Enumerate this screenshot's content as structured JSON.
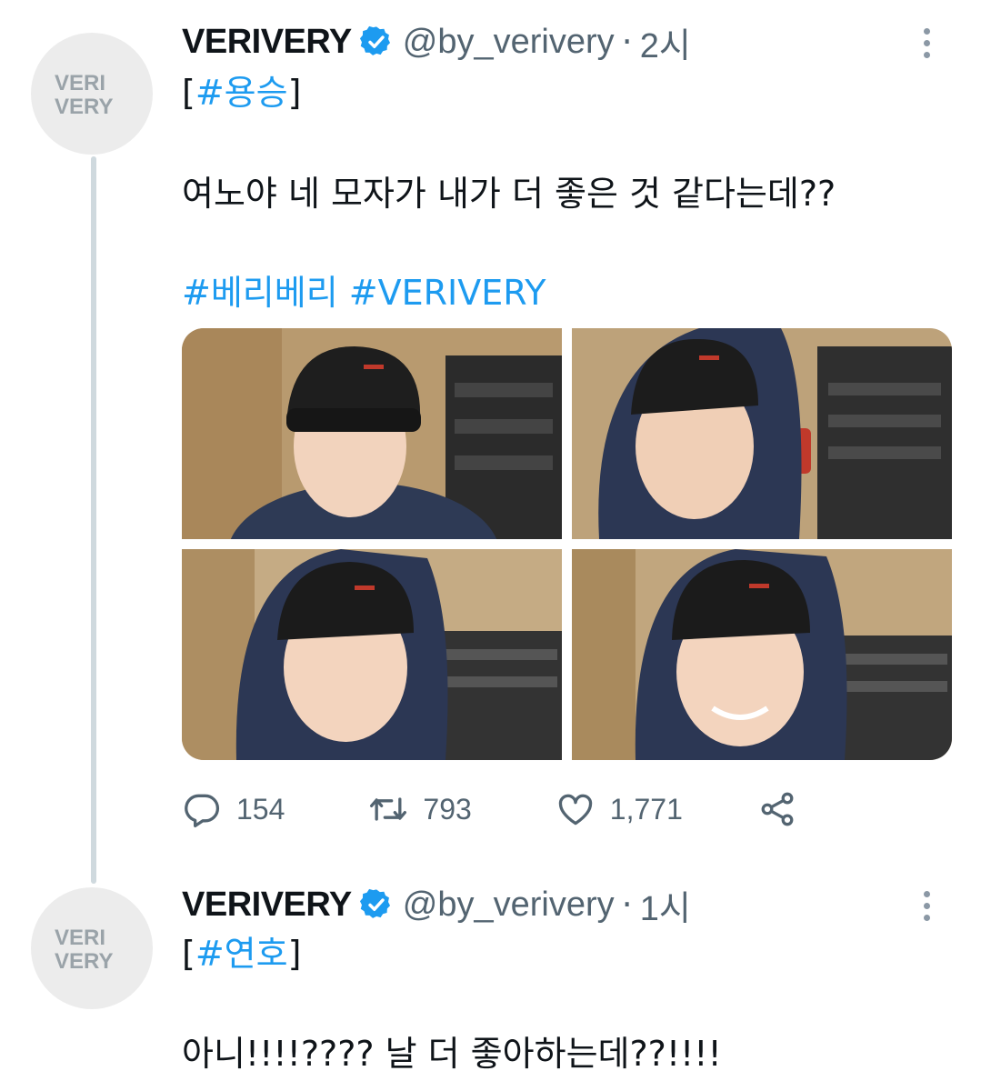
{
  "tweets": [
    {
      "name": "VERIVERY",
      "handle": "@by_verivery",
      "separator": "·",
      "time": "2시",
      "tag_line_open": "[",
      "tag": "#용승",
      "tag_line_close": "]",
      "body": "여노야 네 모자가 내가 더 좋은 것 같다는데??",
      "hashtags": [
        "#베리베리",
        "#VERIVERY"
      ],
      "stats": {
        "replies": "154",
        "retweets": "793",
        "likes": "1,771"
      }
    },
    {
      "name": "VERIVERY",
      "handle": "@by_verivery",
      "separator": "·",
      "time": "1시",
      "tag_line_open": "[",
      "tag": "#연호",
      "tag_line_close": "]",
      "body": "아니!!!!???? 날 더 좋아하는데??!!!!"
    }
  ],
  "avatar_logo_text": [
    "VERI",
    "VERY"
  ],
  "colors": {
    "hashtag": "#1d9bf0",
    "secondary": "#536471",
    "verified": "#1d9bf0"
  },
  "icons": [
    "verified-badge-icon",
    "more-icon",
    "reply-icon",
    "retweet-icon",
    "like-icon",
    "share-icon"
  ]
}
